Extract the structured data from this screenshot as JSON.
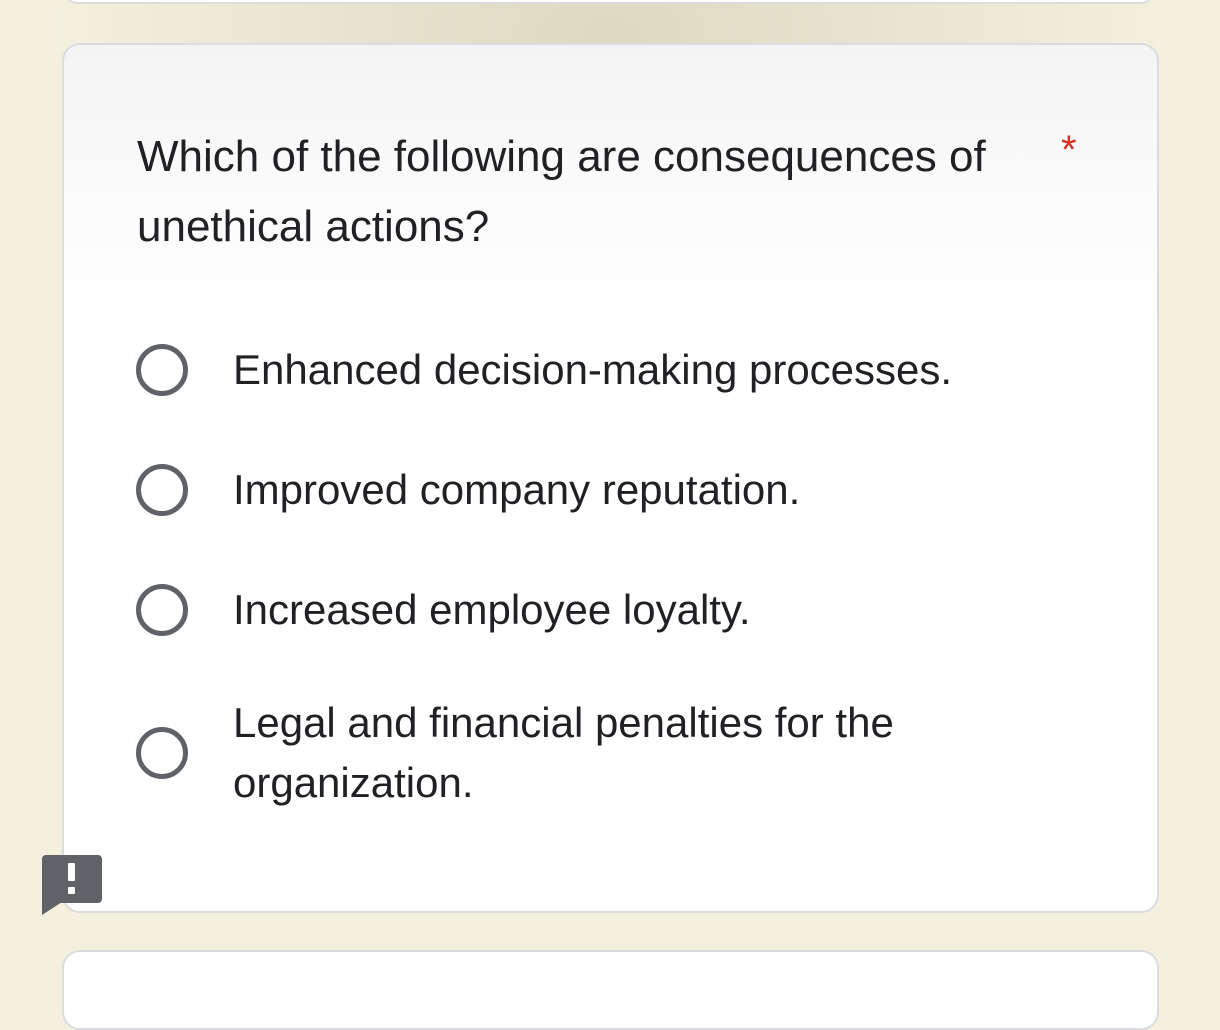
{
  "form": {
    "question": {
      "text": "Which of the following are consequences of unethical actions?",
      "required_marker": "*"
    },
    "options": [
      {
        "label": "Enhanced decision-making processes.",
        "selected": false
      },
      {
        "label": "Improved company reputation.",
        "selected": false
      },
      {
        "label": "Increased employee loyalty.",
        "selected": false
      },
      {
        "label": "Legal and financial penalties for the organization.",
        "selected": false
      }
    ],
    "report_icon": "exclamation-flag-icon"
  },
  "colors": {
    "page_background": "#f3f1de",
    "card_background": "#ffffff",
    "text": "#202124",
    "radio_border": "#5f6368",
    "required": "#d93025",
    "card_border": "#dadce0"
  }
}
